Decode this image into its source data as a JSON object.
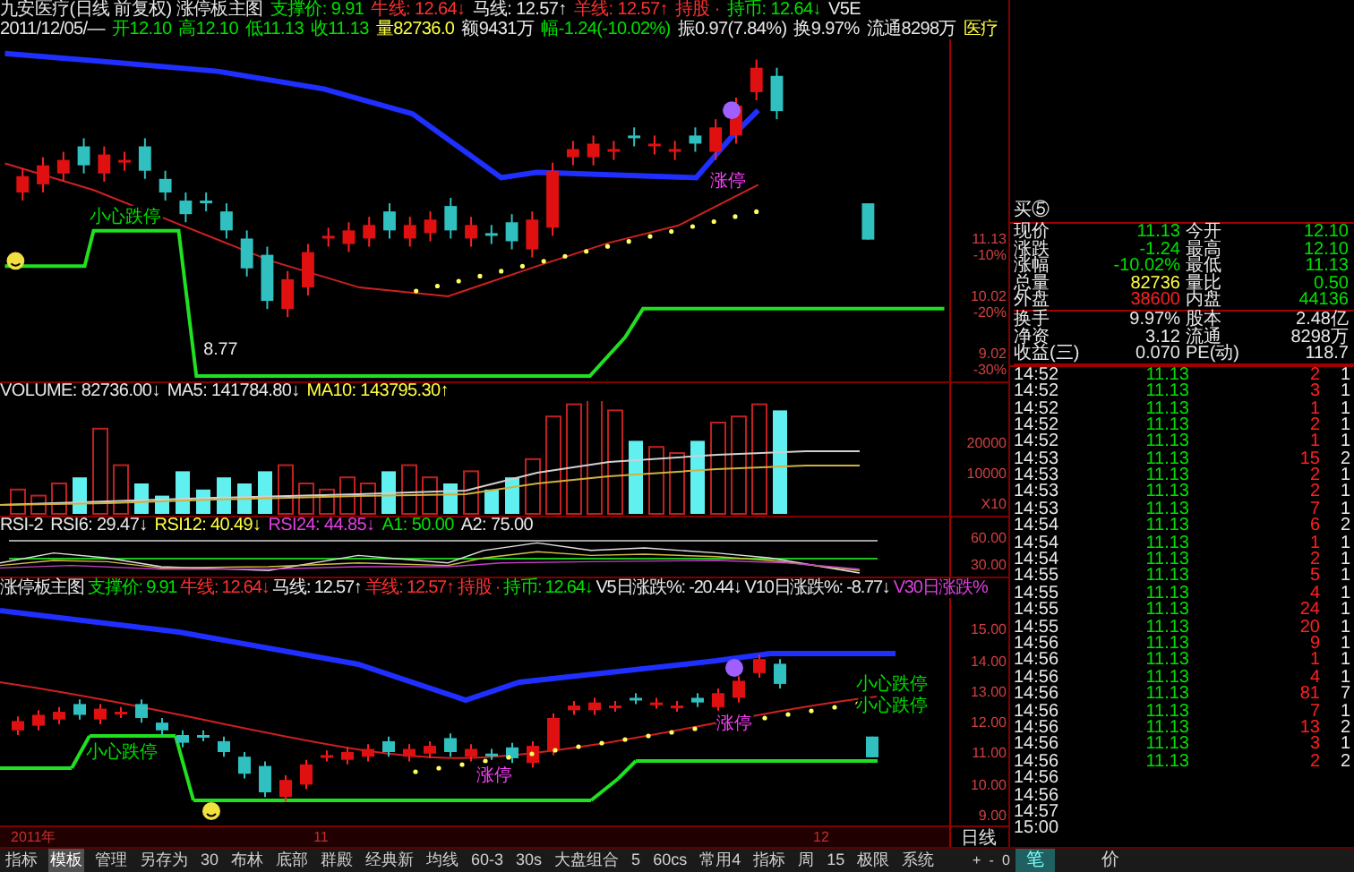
{
  "header": {
    "line1": [
      {
        "text": "九安医疗(日线 前复权) 涨停板主图",
        "color": "#e8e8e8"
      },
      {
        "text": "支撑价: 9.91",
        "color": "#00e000"
      },
      {
        "text": "牛线: 12.64↓",
        "color": "#ff3030"
      },
      {
        "text": "马线: 12.57↑",
        "color": "#e8e8e8"
      },
      {
        "text": "羊线: 12.57↑",
        "color": "#ff3030"
      },
      {
        "text": "持股 ·",
        "color": "#ff3030"
      },
      {
        "text": "持币: 12.64↓",
        "color": "#00e000"
      },
      {
        "text": "V5E",
        "color": "#e8e8e8"
      }
    ],
    "line2": [
      {
        "text": "2011/12/05/—",
        "color": "#e8e8e8"
      },
      {
        "text": "开12.10",
        "color": "#00e000"
      },
      {
        "text": "高12.10",
        "color": "#00e000"
      },
      {
        "text": "低11.13",
        "color": "#00e000"
      },
      {
        "text": "收11.13",
        "color": "#00e000"
      },
      {
        "text": "量82736.0",
        "color": "#ffff40"
      },
      {
        "text": "额9431万",
        "color": "#e8e8e8"
      },
      {
        "text": "幅-1.24(-10.02%)",
        "color": "#00e000"
      },
      {
        "text": "振0.97(7.84%)",
        "color": "#e8e8e8"
      },
      {
        "text": "换9.97%",
        "color": "#e8e8e8"
      },
      {
        "text": "流通8298万",
        "color": "#e8e8e8"
      },
      {
        "text": "医疗",
        "color": "#ffff40"
      }
    ]
  },
  "main_chart": {
    "axis": [
      {
        "value": "11.13",
        "pct": "-10%"
      },
      {
        "value": "10.02",
        "pct": "-20%"
      },
      {
        "value": "9.02",
        "pct": "-30%"
      }
    ],
    "annotations": [
      {
        "text": "小心跌停",
        "kind": "warning"
      },
      {
        "text": "涨停",
        "kind": "limit-up"
      },
      {
        "text": "8.77",
        "kind": "price"
      }
    ]
  },
  "volume": {
    "header": [
      {
        "text": "VOLUME: 82736.00↓",
        "color": "#e8e8e8"
      },
      {
        "text": "MA5: 141784.80↓",
        "color": "#e8e8e8"
      },
      {
        "text": "MA10: 143795.30↑",
        "color": "#ffff40"
      }
    ],
    "axis": [
      "20000",
      "10000",
      "X10"
    ]
  },
  "rsi": {
    "header": [
      {
        "text": "RSI-2",
        "color": "#e8e8e8"
      },
      {
        "text": "RSI6: 29.47↓",
        "color": "#e8e8e8"
      },
      {
        "text": "RSI12: 40.49↓",
        "color": "#ffff40"
      },
      {
        "text": "RSI24: 44.85↓",
        "color": "#e040e0"
      },
      {
        "text": "A1: 50.00",
        "color": "#00e000"
      },
      {
        "text": "A2: 75.00",
        "color": "#e8e8e8"
      }
    ],
    "axis": [
      "60.00",
      "30.00"
    ]
  },
  "lower_chart": {
    "header": [
      {
        "text": "涨停板主图",
        "color": "#e8e8e8"
      },
      {
        "text": "支撑价: 9.91",
        "color": "#00e000"
      },
      {
        "text": "牛线: 12.64↓",
        "color": "#ff3030"
      },
      {
        "text": "马线: 12.57↑",
        "color": "#e8e8e8"
      },
      {
        "text": "羊线: 12.57↑",
        "color": "#ff3030"
      },
      {
        "text": "持股 ·",
        "color": "#ff3030"
      },
      {
        "text": "持币: 12.64↓",
        "color": "#00e000"
      },
      {
        "text": "V5日涨跌%: -20.44↓",
        "color": "#e8e8e8"
      },
      {
        "text": "V10日涨跌%: -8.77↓",
        "color": "#e8e8e8"
      },
      {
        "text": "V30日涨跌%",
        "color": "#e040e0"
      }
    ],
    "axis": [
      "15.00",
      "14.00",
      "13.00",
      "12.00",
      "11.00",
      "10.00",
      "9.00"
    ],
    "annotations": [
      {
        "text": "小心跌停",
        "kind": "warning"
      },
      {
        "text": "涨停",
        "kind": "limit-up"
      },
      {
        "text": "涨停",
        "kind": "limit-up"
      },
      {
        "text": "小心跌停",
        "kind": "warning"
      },
      {
        "text": "小心跌停",
        "kind": "warning"
      }
    ]
  },
  "date_axis": [
    "2011年",
    "11",
    "12"
  ],
  "period_label": "日线",
  "zoom_controls": [
    "+",
    "-",
    "0"
  ],
  "toolbar": [
    {
      "label": "指标",
      "selected": false
    },
    {
      "label": "模板",
      "selected": true
    },
    {
      "label": "管理",
      "selected": false
    },
    {
      "label": "另存为",
      "selected": false
    },
    {
      "label": "30",
      "selected": false
    },
    {
      "label": "布林",
      "selected": false
    },
    {
      "label": "底部",
      "selected": false
    },
    {
      "label": "群殿",
      "selected": false
    },
    {
      "label": "经典新",
      "selected": false
    },
    {
      "label": "均线",
      "selected": false
    },
    {
      "label": "60-3",
      "selected": false
    },
    {
      "label": "30s",
      "selected": false
    },
    {
      "label": "大盘组合",
      "selected": false
    },
    {
      "label": "5",
      "selected": false
    },
    {
      "label": "60cs",
      "selected": false
    },
    {
      "label": "常用4",
      "selected": false
    },
    {
      "label": "指标",
      "selected": false
    },
    {
      "label": "周",
      "selected": false
    },
    {
      "label": "15",
      "selected": false
    },
    {
      "label": "极限",
      "selected": false
    },
    {
      "label": "系统",
      "selected": false
    }
  ],
  "quote": {
    "order_level": "买⑤",
    "cells": [
      {
        "label": "现价",
        "value": "11.13",
        "color": "#00e000"
      },
      {
        "label": "今开",
        "value": "12.10",
        "color": "#00e000"
      },
      {
        "label": "涨跌",
        "value": "-1.24",
        "color": "#00e000"
      },
      {
        "label": "最高",
        "value": "12.10",
        "color": "#00e000"
      },
      {
        "label": "涨幅",
        "value": "-10.02%",
        "color": "#00e000"
      },
      {
        "label": "最低",
        "value": "11.13",
        "color": "#00e000"
      },
      {
        "label": "总量",
        "value": "82736",
        "color": "#ffff40"
      },
      {
        "label": "量比",
        "value": "0.50",
        "color": "#00e000"
      },
      {
        "label": "外盘",
        "value": "38600",
        "color": "#ff2020"
      },
      {
        "label": "内盘",
        "value": "44136",
        "color": "#00e000"
      },
      {
        "label": "换手",
        "value": "9.97%",
        "color": "#e8e8e8"
      },
      {
        "label": "股本",
        "value": "2.48亿",
        "color": "#e8e8e8"
      },
      {
        "label": "净资",
        "value": "3.12",
        "color": "#e8e8e8"
      },
      {
        "label": "流通",
        "value": "8298万",
        "color": "#e8e8e8"
      },
      {
        "label": "收益(三)",
        "value": "0.070",
        "color": "#e8e8e8"
      },
      {
        "label": "PE(动)",
        "value": "118.7",
        "color": "#e8e8e8"
      }
    ]
  },
  "ticks": [
    {
      "time": "14:52",
      "price": "11.13",
      "volume": "2",
      "count": "1"
    },
    {
      "time": "14:52",
      "price": "11.13",
      "volume": "3",
      "count": "1"
    },
    {
      "time": "14:52",
      "price": "11.13",
      "volume": "1",
      "count": "1"
    },
    {
      "time": "14:52",
      "price": "11.13",
      "volume": "2",
      "count": "1"
    },
    {
      "time": "14:52",
      "price": "11.13",
      "volume": "1",
      "count": "1"
    },
    {
      "time": "14:53",
      "price": "11.13",
      "volume": "15",
      "count": "2"
    },
    {
      "time": "14:53",
      "price": "11.13",
      "volume": "2",
      "count": "1"
    },
    {
      "time": "14:53",
      "price": "11.13",
      "volume": "2",
      "count": "1"
    },
    {
      "time": "14:53",
      "price": "11.13",
      "volume": "7",
      "count": "1"
    },
    {
      "time": "14:54",
      "price": "11.13",
      "volume": "6",
      "count": "2"
    },
    {
      "time": "14:54",
      "price": "11.13",
      "volume": "1",
      "count": "1"
    },
    {
      "time": "14:54",
      "price": "11.13",
      "volume": "2",
      "count": "1"
    },
    {
      "time": "14:55",
      "price": "11.13",
      "volume": "5",
      "count": "1"
    },
    {
      "time": "14:55",
      "price": "11.13",
      "volume": "4",
      "count": "1"
    },
    {
      "time": "14:55",
      "price": "11.13",
      "volume": "24",
      "count": "1"
    },
    {
      "time": "14:55",
      "price": "11.13",
      "volume": "20",
      "count": "1"
    },
    {
      "time": "14:56",
      "price": "11.13",
      "volume": "9",
      "count": "1"
    },
    {
      "time": "14:56",
      "price": "11.13",
      "volume": "1",
      "count": "1"
    },
    {
      "time": "14:56",
      "price": "11.13",
      "volume": "4",
      "count": "1"
    },
    {
      "time": "14:56",
      "price": "11.13",
      "volume": "81",
      "count": "7"
    },
    {
      "time": "14:56",
      "price": "11.13",
      "volume": "7",
      "count": "1"
    },
    {
      "time": "14:56",
      "price": "11.13",
      "volume": "13",
      "count": "2"
    },
    {
      "time": "14:56",
      "price": "11.13",
      "volume": "3",
      "count": "1"
    },
    {
      "time": "14:56",
      "price": "11.13",
      "volume": "2",
      "count": "2"
    },
    {
      "time": "14:56"
    },
    {
      "time": "14:56"
    },
    {
      "time": "14:57"
    },
    {
      "time": "15:00"
    }
  ],
  "detail_tabs": [
    {
      "label": "笔",
      "selected": true
    },
    {
      "label": "价",
      "selected": false
    }
  ]
}
